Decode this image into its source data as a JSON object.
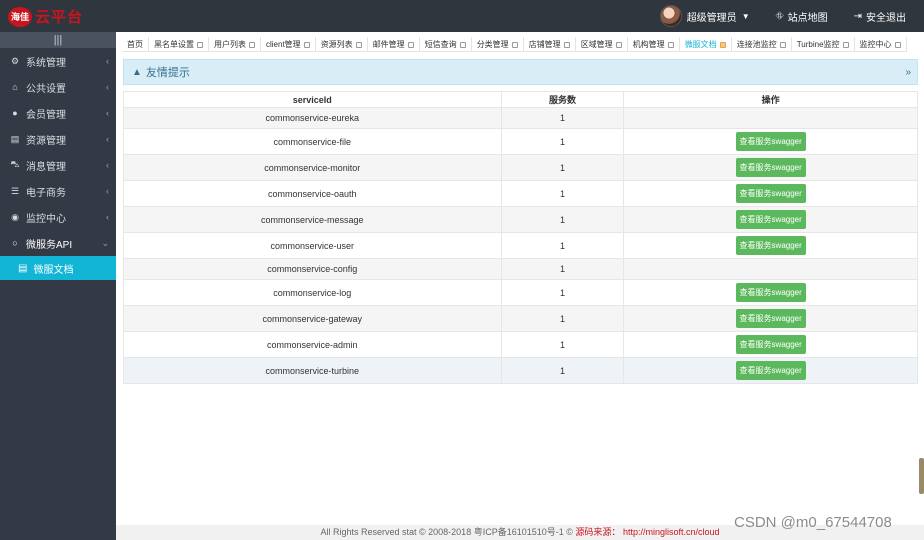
{
  "header": {
    "logo_badge": "海佳",
    "logo_text": "云平台",
    "user_name": "超级管理员",
    "site_map": "站点地图",
    "logout": "安全退出"
  },
  "sidebar": {
    "toggle_icon": "|||",
    "items": [
      {
        "label": "系统管理",
        "icon": "gears-icon"
      },
      {
        "label": "公共设置",
        "icon": "bank-icon"
      },
      {
        "label": "会员管理",
        "icon": "user-icon"
      },
      {
        "label": "资源管理",
        "icon": "file-icon"
      },
      {
        "label": "消息管理",
        "icon": "car-icon"
      },
      {
        "label": "电子商务",
        "icon": "sliders-icon"
      },
      {
        "label": "监控中心",
        "icon": "dashboard-icon"
      },
      {
        "label": "微服务API",
        "icon": "circle-icon"
      }
    ],
    "sub_active": "微服文档"
  },
  "tabs": [
    {
      "label": "首页",
      "closable": false
    },
    {
      "label": "黑名单设置",
      "closable": true
    },
    {
      "label": "用户列表",
      "closable": true
    },
    {
      "label": "client管理",
      "closable": true
    },
    {
      "label": "资源列表",
      "closable": true
    },
    {
      "label": "邮件管理",
      "closable": true
    },
    {
      "label": "短信查询",
      "closable": true
    },
    {
      "label": "分类管理",
      "closable": true
    },
    {
      "label": "店铺管理",
      "closable": true
    },
    {
      "label": "区域管理",
      "closable": true
    },
    {
      "label": "机构管理",
      "closable": true
    },
    {
      "label": "微服文档",
      "closable": true,
      "active": true
    },
    {
      "label": "连接池监控",
      "closable": true
    },
    {
      "label": "Turbine监控",
      "closable": true
    },
    {
      "label": "监控中心",
      "closable": true
    }
  ],
  "notice": {
    "title": "友情提示"
  },
  "table": {
    "headers": [
      "serviceId",
      "服务数",
      "操作"
    ],
    "button_label": "查看服务swagger",
    "rows": [
      {
        "service": "commonservice-eureka",
        "count": "1",
        "has_button": false
      },
      {
        "service": "commonservice-file",
        "count": "1",
        "has_button": true
      },
      {
        "service": "commonservice-monitor",
        "count": "1",
        "has_button": true
      },
      {
        "service": "commonservice-oauth",
        "count": "1",
        "has_button": true
      },
      {
        "service": "commonservice-message",
        "count": "1",
        "has_button": true
      },
      {
        "service": "commonservice-user",
        "count": "1",
        "has_button": true
      },
      {
        "service": "commonservice-config",
        "count": "1",
        "has_button": false
      },
      {
        "service": "commonservice-log",
        "count": "1",
        "has_button": true
      },
      {
        "service": "commonservice-gateway",
        "count": "1",
        "has_button": true
      },
      {
        "service": "commonservice-admin",
        "count": "1",
        "has_button": true
      },
      {
        "service": "commonservice-turbine",
        "count": "1",
        "has_button": true
      }
    ]
  },
  "footer": {
    "text": "All Rights Reserved stat © 2008-2018 粤ICP备16101510号-1 ©",
    "source_label": "源码来源：",
    "source_url": "http://minglisoft.cn/cloud"
  },
  "watermark": "CSDN @m0_67544708"
}
